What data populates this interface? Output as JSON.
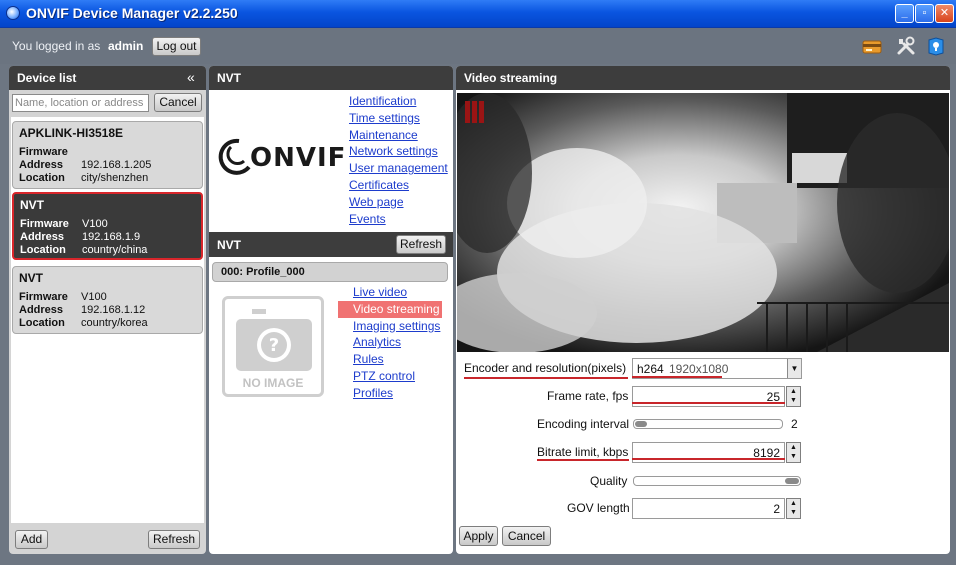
{
  "window": {
    "title": "ONVIF Device Manager v2.2.250"
  },
  "header": {
    "logged_in_text": "You logged in as",
    "username": "admin",
    "logout_label": "Log out"
  },
  "device_list": {
    "title": "Device list",
    "collapse_glyph": "«",
    "search_placeholder": "Name, location or address",
    "cancel_label": "Cancel",
    "devices": [
      {
        "name": "APKLINK-HI3518E",
        "firmware_label": "Firmware",
        "firmware": "",
        "address_label": "Address",
        "address": "192.168.1.205",
        "location_label": "Location",
        "location": "city/shenzhen"
      },
      {
        "name": "NVT",
        "firmware_label": "Firmware",
        "firmware": "V100",
        "address_label": "Address",
        "address": "192.168.1.9",
        "location_label": "Location",
        "location": "country/china"
      },
      {
        "name": "NVT",
        "firmware_label": "Firmware",
        "firmware": "V100",
        "address_label": "Address",
        "address": "192.168.1.12",
        "location_label": "Location",
        "location": "country/korea"
      }
    ],
    "add_label": "Add",
    "refresh_label": "Refresh"
  },
  "nvt_panel": {
    "title": "NVT",
    "logo_text": "ONVIF",
    "device_links": [
      "Identification",
      "Time settings",
      "Maintenance",
      "Network settings",
      "User management",
      "Certificates",
      "Web page",
      "Events"
    ],
    "section_title": "NVT",
    "refresh_label": "Refresh",
    "profile_title": "000: Profile_000",
    "no_image_text": "NO IMAGE",
    "profile_links": [
      "Live video",
      "Video streaming",
      "Imaging settings",
      "Analytics",
      "Rules",
      "PTZ control",
      "Profiles"
    ],
    "active_link": "Video streaming"
  },
  "video_panel": {
    "title": "Video streaming",
    "encoder_label": "Encoder and resolution(pixels)",
    "encoder_codec": "h264",
    "encoder_resolution": "1920x1080",
    "frame_rate_label": "Frame rate, fps",
    "frame_rate_value": "25",
    "encoding_interval_label": "Encoding interval",
    "encoding_interval_value": "2",
    "bitrate_label": "Bitrate limit, kbps",
    "bitrate_value": "8192",
    "quality_label": "Quality",
    "gov_label": "GOV length",
    "gov_value": "2",
    "apply_label": "Apply",
    "cancel_label": "Cancel"
  },
  "colors": {
    "titlebar": "#0a55e0",
    "panel_header": "#3d3d3d",
    "selection_border": "#d8262b",
    "link": "#1d3ccc",
    "active_link_bg": "#f07272",
    "annotation_underline": "#c8262b"
  },
  "icons": [
    "onvif-app-icon",
    "minimize-icon",
    "maximize-icon",
    "close-icon",
    "credit-card-icon",
    "tools-icon",
    "help-icon",
    "collapse-icon",
    "camera-placeholder-icon",
    "dropdown-arrow-icon",
    "spin-up-icon",
    "spin-down-icon"
  ]
}
